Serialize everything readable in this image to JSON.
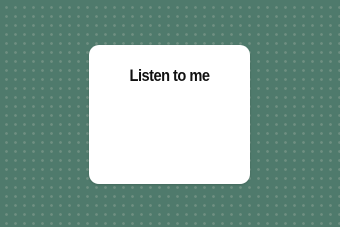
{
  "card": {
    "title": "Listen to me"
  },
  "colors": {
    "background": "#4f7a6c",
    "pattern_dot": "#6f8f82",
    "card": "#ffffff",
    "title_text": "#111111"
  }
}
